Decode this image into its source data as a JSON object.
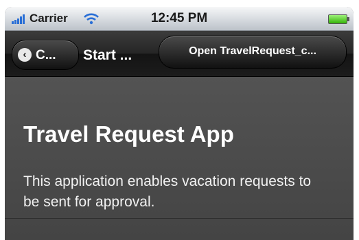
{
  "status_bar": {
    "carrier": "Carrier",
    "time": "12:45 PM",
    "signal_icon": "signal-bars-icon",
    "wifi_icon": "wifi-icon",
    "battery_icon": "battery-icon"
  },
  "nav": {
    "back_label": "C...",
    "title": "Start ...",
    "open_button_label": "Open TravelRequest_c..."
  },
  "content": {
    "heading": "Travel Request App",
    "description": "This application enables vacation requests to be sent for approval."
  },
  "colors": {
    "background": "#4a4a4a",
    "navbar": "#1c1c1c",
    "text": "#ffffff",
    "signal": "#2a6fd6",
    "battery": "#36b50a"
  }
}
